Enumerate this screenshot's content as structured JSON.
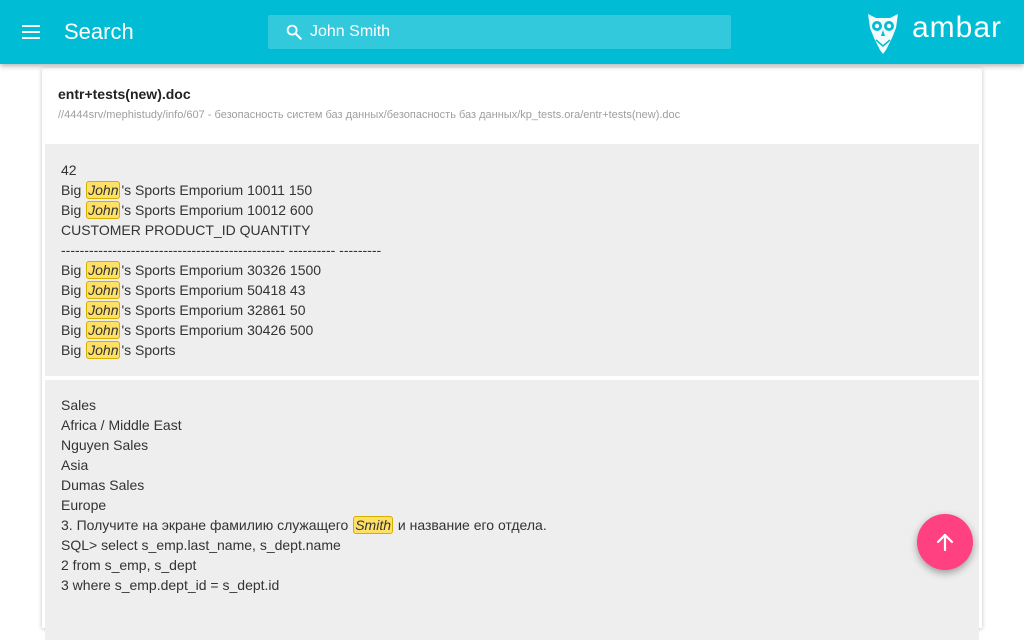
{
  "header": {
    "title": "Search",
    "search_value": "John Smith",
    "logo_text": "ambar"
  },
  "result": {
    "file_name": "entr+tests(new).doc",
    "file_path": "//4444srv/mephistudy/info/607 - безопасность систем баз данных/безопасность баз данных/kp_tests.ora/entr+tests(new).doc"
  },
  "snippets": [
    {
      "lines": [
        [
          "42"
        ],
        [
          "Big ",
          {
            "hl": "John"
          },
          "'s Sports Emporium 10011 150"
        ],
        [
          "Big ",
          {
            "hl": "John"
          },
          "'s Sports Emporium 10012 600"
        ],
        [
          "CUSTOMER PRODUCT_ID QUANTITY"
        ],
        [
          "------------------------------------------------ ---------- ---------"
        ],
        [
          "Big ",
          {
            "hl": "John"
          },
          "'s Sports Emporium 30326 1500"
        ],
        [
          "Big ",
          {
            "hl": "John"
          },
          "'s Sports Emporium 50418 43"
        ],
        [
          "Big ",
          {
            "hl": "John"
          },
          "'s Sports Emporium 32861 50"
        ],
        [
          "Big ",
          {
            "hl": "John"
          },
          "'s Sports Emporium 30426 500"
        ],
        [
          "Big ",
          {
            "hl": "John"
          },
          "'s Sports"
        ]
      ]
    },
    {
      "lines": [
        [
          "Sales"
        ],
        [
          "Africa / Middle East"
        ],
        [
          "Nguyen Sales"
        ],
        [
          "Asia"
        ],
        [
          "Dumas Sales"
        ],
        [
          "Europe"
        ],
        [
          "3. Получите на экране фамилию служащего ",
          {
            "hl": "Smith"
          },
          " и название его отдела."
        ],
        [
          "SQL> select s_emp.last_name, s_dept.name"
        ],
        [
          "2 from s_emp, s_dept"
        ],
        [
          "3 where s_emp.dept_id = s_dept.id"
        ]
      ]
    }
  ],
  "colors": {
    "appbar": "#00bcd4",
    "fab": "#ff4081",
    "highlight": "#ffe066"
  },
  "icons": {
    "menu": "menu-icon",
    "search": "search-icon",
    "logo": "owl-logo-icon",
    "fab": "arrow-up-icon"
  }
}
